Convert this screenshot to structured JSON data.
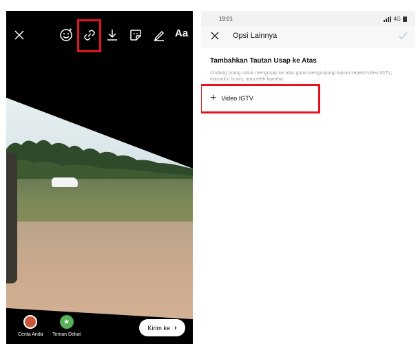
{
  "left": {
    "toolbar": {
      "text_tool_label": "Aa"
    },
    "bottom": {
      "story_label": "Cerita Anda",
      "close_friends_label": "Teman Dekat",
      "send_label": "Kirim ke"
    },
    "highlight_color": "#e4141e"
  },
  "right": {
    "status": {
      "time": "19:01",
      "network": "4G"
    },
    "nav": {
      "title": "Opsi Lainnya"
    },
    "section": {
      "title": "Tambahkan Tautan Usap ke Atas",
      "description": "Undang orang untuk mengusap ke atas guna mengunjungi tujuan seperti video IGTV, transaksi bisnis, atau efek kamera."
    },
    "option": {
      "label": "Video IGTV"
    },
    "accent_color": "#5aa8e6"
  }
}
